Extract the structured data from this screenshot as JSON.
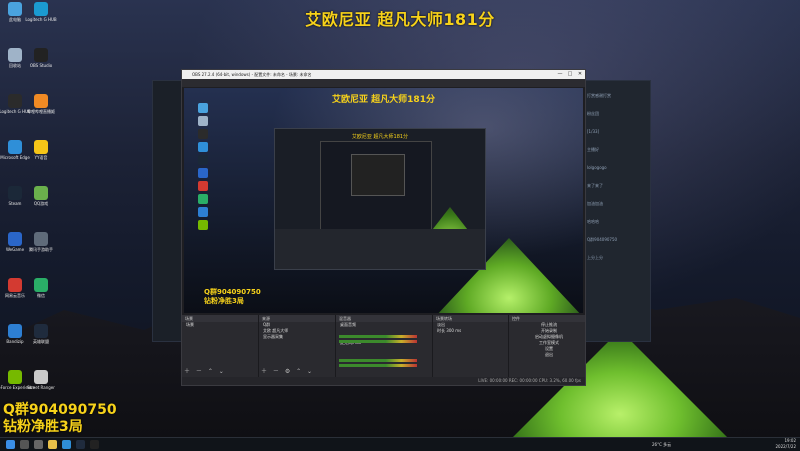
{
  "stream": {
    "title": "艾欧尼亚 超凡大师181分",
    "qq_line1": "Q群904090750",
    "qq_line2": "钻粉净胜3局"
  },
  "desktop": {
    "icons": [
      {
        "label": "此电脑",
        "color": "#4aa3df"
      },
      {
        "label": "Logitech G HUB",
        "color": "#1b9bd1"
      },
      {
        "label": "回收站",
        "color": "#9fb3c8"
      },
      {
        "label": "OBS Studio",
        "color": "#222222"
      },
      {
        "label": "Logitech G HUB",
        "color": "#2b2b2b"
      },
      {
        "label": "哔哩哔哩直播姬",
        "color": "#f08a24"
      },
      {
        "label": "Microsoft Edge",
        "color": "#2f8fd8"
      },
      {
        "label": "YY语音",
        "color": "#f5c518"
      },
      {
        "label": "Steam",
        "color": "#1b2838"
      },
      {
        "label": "QQ游戏",
        "color": "#6ab04c"
      },
      {
        "label": "WeGame",
        "color": "#2a66c9"
      },
      {
        "label": "腾讯手游助手",
        "color": "#5f6b7a"
      },
      {
        "label": "网易云音乐",
        "color": "#d33a31"
      },
      {
        "label": "微信",
        "color": "#2aae67"
      },
      {
        "label": "Bandizip",
        "color": "#2d7fd3"
      },
      {
        "label": "英雄联盟",
        "color": "#1f2b3d"
      },
      {
        "label": "GeForce Experience",
        "color": "#76b900"
      },
      {
        "label": "Street Ranger",
        "color": "#c9c9c9"
      }
    ]
  },
  "obs": {
    "window_title": "OBS 27.2.4 (64-bit, windows) - 配置文件: 未命名 - 场景: 未命名",
    "menu": [
      "文件(F)",
      "编辑(E)",
      "视图(V)",
      "停靠部件(D)",
      "配置文件(P)",
      "场景集合(S)",
      "工具(T)",
      "帮助(H)"
    ],
    "docks": {
      "scenes": {
        "header": "场景",
        "items": [
          "场景"
        ]
      },
      "sources": {
        "header": "来源",
        "items": [
          "Q群",
          "艾欧 超凡大师",
          "显示器采集"
        ]
      },
      "mixer": {
        "header": "混音器",
        "channels": [
          "桌面音频",
          "麦克风/Aux"
        ]
      },
      "transitions": {
        "header": "场景转场",
        "type": "淡出",
        "duration_label": "时长",
        "duration": "300 ms"
      },
      "controls": {
        "header": "控件",
        "buttons": [
          "停止推流",
          "开始录制",
          "启动虚拟摄像机",
          "工作室模式",
          "设置",
          "退出"
        ]
      }
    },
    "status": "LIVE: 00:00:00  REC: 00:00:00  CPU: 3.2%, 60.00 fps"
  },
  "background_window": {
    "chat": [
      "打赏感谢打赏",
      "粉丝团",
      "[1/33]",
      "主播好",
      "lolgogogo",
      "来了来了",
      "加油加油",
      "哈哈哈",
      "Q群904090750",
      "上分上分"
    ]
  },
  "taskbar": {
    "weather": "26°C 多云",
    "time": "19:02",
    "date": "2022/7/22"
  }
}
